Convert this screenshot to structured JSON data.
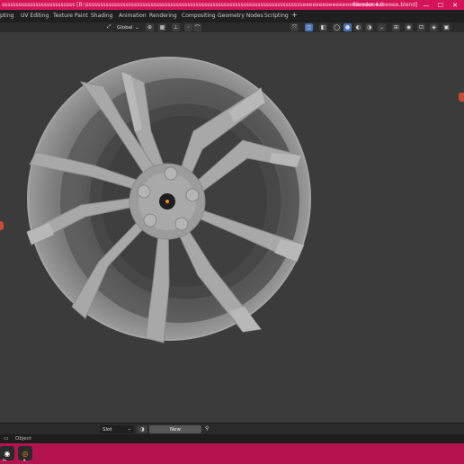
{
  "title_bar": {
    "text": "ssssssssssssssssssssssssss [B:\\ssssssssssssssssssssssssssssssssssssssssssssssssssssssssssssssssssssssssssssseeeeeeeeeeeeeeeeeeeeeeeeeeeee.blend]",
    "app_version": "Blender 4.0",
    "minimize": "—",
    "maximize": "☐",
    "close": "✕"
  },
  "workspaces": [
    "pting",
    "UV Editing",
    "Texture Paint",
    "Shading",
    "Animation",
    "Rendering",
    "Compositing",
    "Geometry Nodes",
    "Scripting",
    "+"
  ],
  "toolbar": {
    "transform_orientation": "Global"
  },
  "bottom": {
    "slot": "Slot",
    "new": "New"
  },
  "status": {
    "mode": "Object"
  },
  "taskbar": {
    "items": [
      "Ps",
      "B"
    ]
  },
  "colors": {
    "accent": "#d4145a",
    "viewport": "#3b3b3b"
  }
}
